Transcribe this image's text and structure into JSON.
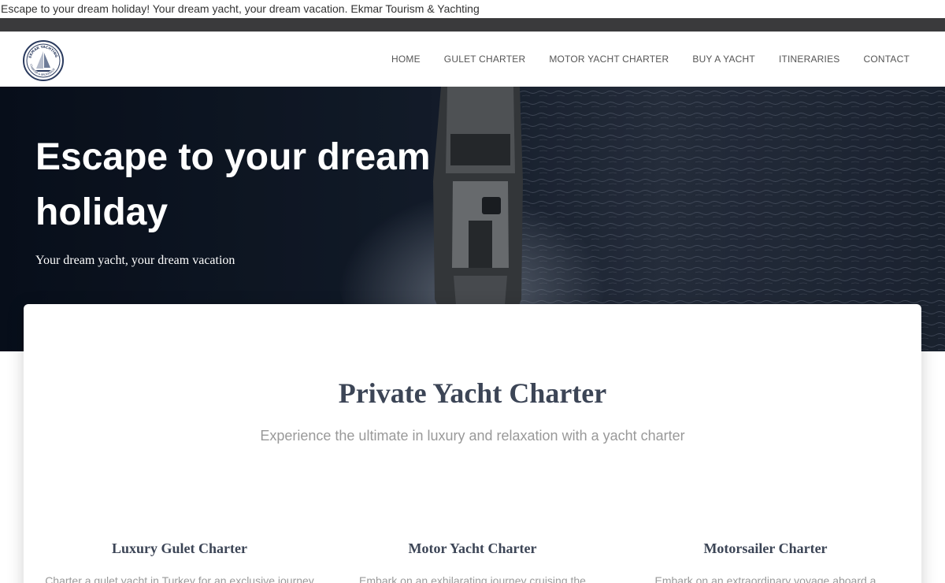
{
  "page_title_line": "Escape to your dream holiday! Your dream yacht, your dream vacation. Ekmar Tourism & Yachting",
  "logo": {
    "name": "Ekmar Yachting logo",
    "top_text": "EKMAR YACHTING",
    "bottom_text": "CHARTER & BROKERAGE"
  },
  "nav": {
    "items": [
      {
        "label": "HOME"
      },
      {
        "label": "GULET CHARTER"
      },
      {
        "label": "MOTOR YACHT CHARTER"
      },
      {
        "label": "BUY A YACHT"
      },
      {
        "label": "ITINERARIES"
      },
      {
        "label": "CONTACT"
      }
    ]
  },
  "hero": {
    "title": "Escape to your dream holiday",
    "subtitle": "Your dream yacht, your dream vacation"
  },
  "section": {
    "title": "Private Yacht Charter",
    "subtitle": "Experience the ultimate in luxury and relaxation with a yacht charter",
    "cards": [
      {
        "title": "Luxury Gulet Charter",
        "text": "Charter a gulet yacht in Turkey for an exclusive journey"
      },
      {
        "title": "Motor Yacht Charter",
        "text": "Embark on an exhilarating journey cruising the"
      },
      {
        "title": "Motorsailer Charter",
        "text": "Embark on an extraordinary voyage aboard a"
      }
    ]
  },
  "colors": {
    "top_dark_bar": "#3a3a3c",
    "heading": "#3c4556",
    "muted_text": "#999999",
    "hero_overlay": "#0c1422"
  }
}
